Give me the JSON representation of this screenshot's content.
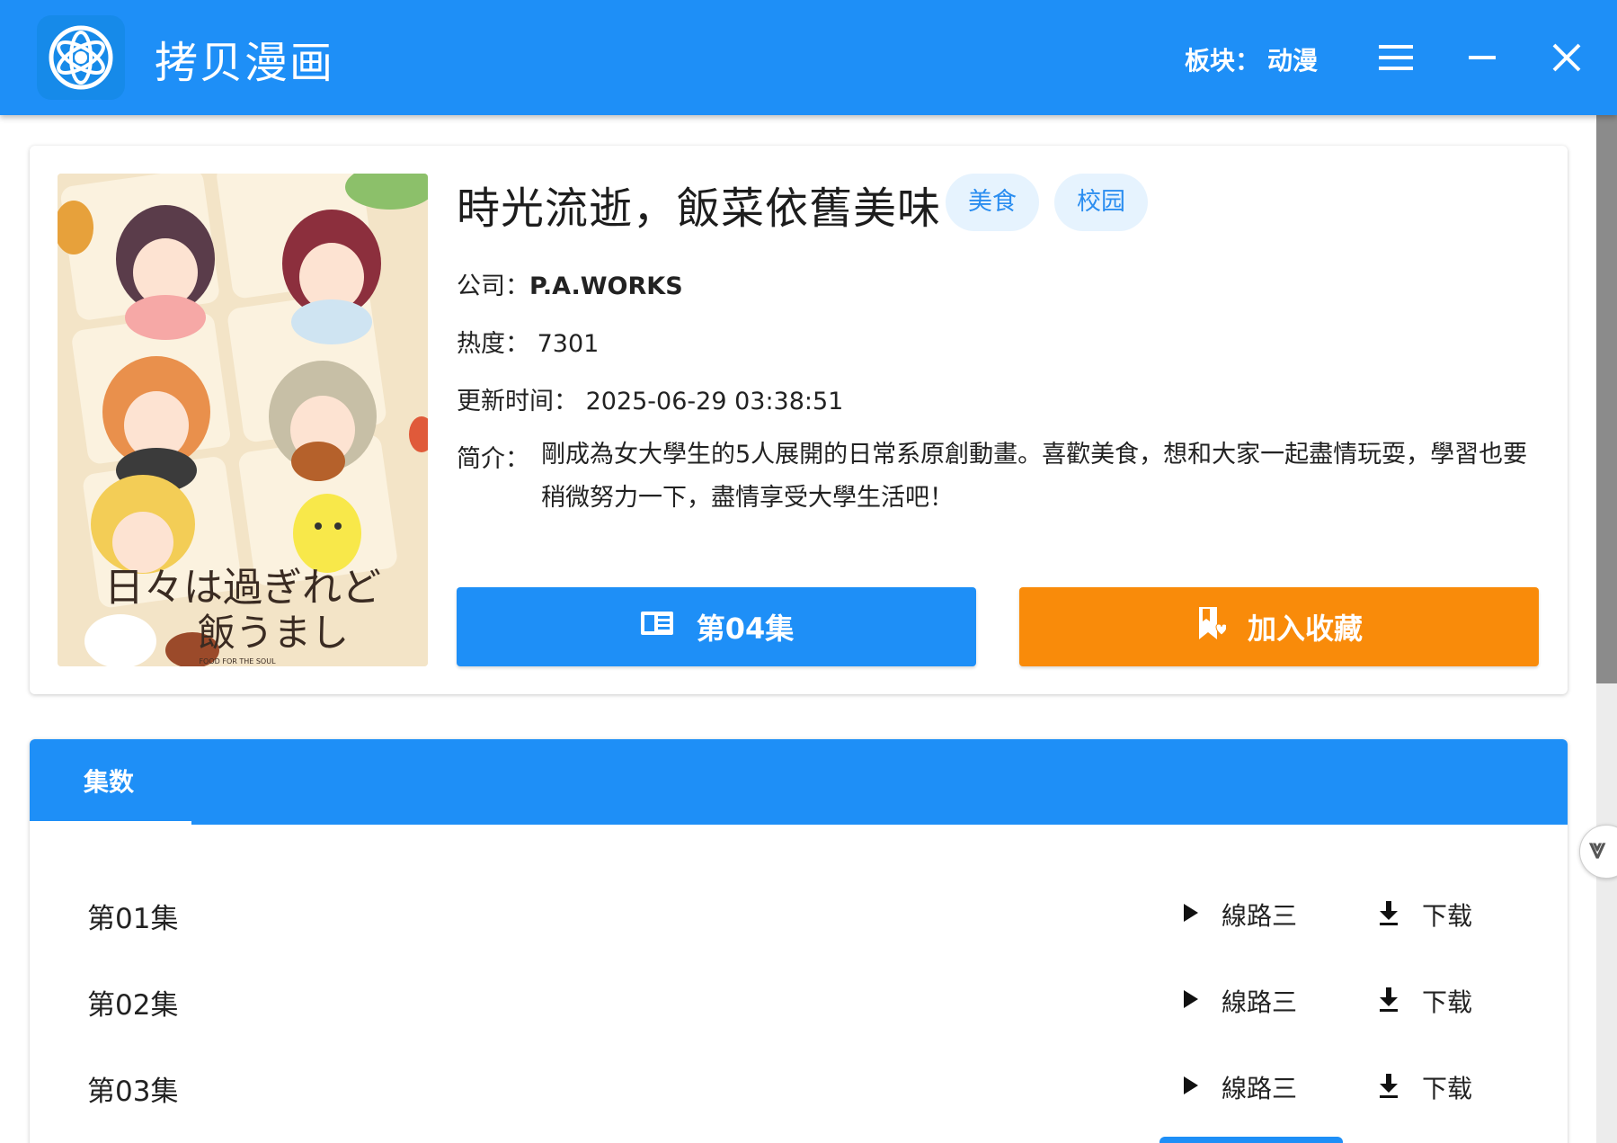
{
  "app": {
    "title": "拷贝漫画",
    "board_label": "板块：",
    "board_value": "动漫"
  },
  "anime": {
    "title": "時光流逝，飯菜依舊美味",
    "tags": [
      "美食",
      "校园"
    ],
    "company_label": "公司：",
    "company_value": "P.A.WORKS",
    "heat_label": "热度：",
    "heat_value": "7301",
    "update_label": "更新时间：",
    "update_value": "2025-06-29 03:38:51",
    "desc_label": "简介：",
    "desc_value": "剛成為女大學生的5人展開的日常系原創動畫。喜歡美食，想和大家一起盡情玩耍，學習也要稍微努力一下，盡情享受大學生活吧！",
    "cover_logo_line1": "日々は過ぎれど",
    "cover_logo_line2": "飯うまし",
    "cover_logo_small": "FOOD FOR THE SOUL"
  },
  "actions": {
    "read_label": "第04集",
    "favorite_label": "加入收藏"
  },
  "episodes_section": {
    "tab_label": "集数",
    "items": [
      {
        "name": "第01集",
        "play_label": "線路三",
        "download_label": "下载"
      },
      {
        "name": "第02集",
        "play_label": "線路三",
        "download_label": "下载"
      },
      {
        "name": "第03集",
        "play_label": "線路三",
        "download_label": "下载"
      }
    ]
  },
  "icons": {
    "app_logo": "atom-logo-icon",
    "menu": "hamburger-menu-icon",
    "minimize": "minimize-icon",
    "close": "close-icon",
    "read": "book-open-icon",
    "favorite": "bookmark-heart-icon",
    "play": "play-triangle-icon",
    "download": "download-icon",
    "scroll_down": "chevron-down-icon"
  },
  "colors": {
    "primary": "#1e8ff7",
    "accent_orange": "#f98b0a",
    "tag_bg": "#e6f3fe",
    "tag_text": "#2a8df0"
  }
}
